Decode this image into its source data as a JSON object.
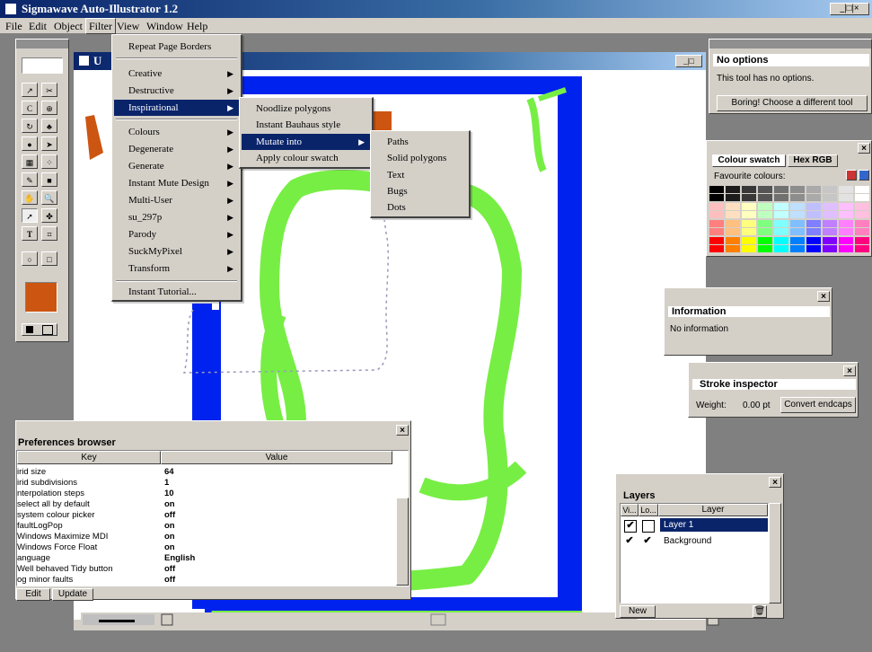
{
  "app": {
    "title": "Sigmawave Auto-Illustrator 1.2",
    "win_controls": "_|□|×"
  },
  "menubar": [
    "File",
    "Edit",
    "Object",
    "Filter",
    "View",
    "Window",
    "Help"
  ],
  "document": {
    "title_visible": "U",
    "controls": "_|□"
  },
  "filter_menu": {
    "items": [
      {
        "label": "Repeat Page Borders",
        "sub": false
      },
      {
        "label": "Creative",
        "sub": true
      },
      {
        "label": "Destructive",
        "sub": true
      },
      {
        "label": "Inspirational",
        "sub": true,
        "highlighted": true
      },
      {
        "label": "Colours",
        "sub": true
      },
      {
        "label": "Degenerate",
        "sub": true
      },
      {
        "label": "Generate",
        "sub": true
      },
      {
        "label": "Instant Mute Design",
        "sub": true
      },
      {
        "label": "Multi-User",
        "sub": true
      },
      {
        "label": "su_297p",
        "sub": true
      },
      {
        "label": "Parody",
        "sub": true
      },
      {
        "label": "SuckMyPixel",
        "sub": true
      },
      {
        "label": "Transform",
        "sub": true
      },
      {
        "label": "Instant Tutorial...",
        "sub": false
      }
    ]
  },
  "inspirational_menu": {
    "items": [
      {
        "label": "Noodlize polygons",
        "sub": false
      },
      {
        "label": "Instant Bauhaus style",
        "sub": false
      },
      {
        "label": "Mutate into",
        "sub": true,
        "highlighted": true
      },
      {
        "label": "Apply colour swatch",
        "sub": false
      }
    ]
  },
  "mutate_menu": {
    "items": [
      "Paths",
      "Solid polygons",
      "Text",
      "Bugs",
      "Dots"
    ]
  },
  "tool_options": {
    "title": "No options",
    "message": "This tool has no options.",
    "button": "Boring! Choose a different tool"
  },
  "colour_panel": {
    "tabs": [
      "Colour swatch",
      "Hex RGB"
    ],
    "favourite_label": "Favourite colours:",
    "colors": {
      "row1": [
        "#000000",
        "#1c1c1c",
        "#383838",
        "#555555",
        "#717171",
        "#8d8d8d",
        "#aaaaaa",
        "#c6c6c6",
        "#e2e2e2",
        "#ffffff"
      ],
      "row2": [
        "#ffbfbf",
        "#ffdfbf",
        "#ffffbf",
        "#bfffbf",
        "#bfffff",
        "#bfdfff",
        "#bfbfff",
        "#dfbfff",
        "#ffbfff",
        "#ffbfdf"
      ],
      "row3": [
        "#ff7f7f",
        "#ffbf7f",
        "#ffff7f",
        "#7fff7f",
        "#7fffff",
        "#7fbfff",
        "#7f7fff",
        "#bf7fff",
        "#ff7fff",
        "#ff7fbf"
      ],
      "row4": [
        "#ff0000",
        "#ff7f00",
        "#ffff00",
        "#00ff00",
        "#00ffff",
        "#007fff",
        "#0000ff",
        "#7f00ff",
        "#ff00ff",
        "#ff007f"
      ]
    }
  },
  "information": {
    "title": "Information",
    "text": "No information"
  },
  "stroke": {
    "title": "Stroke inspector",
    "weight_label": "Weight:",
    "weight_value": "0.00 pt",
    "button": "Convert endcaps"
  },
  "layers": {
    "title": "Layers",
    "cols": [
      "Vi...",
      "Lo...",
      "Layer"
    ],
    "rows": [
      {
        "visible": "✔",
        "locked": "",
        "name": "Layer 1",
        "selected": true
      },
      {
        "visible": "✔",
        "locked": "✔",
        "name": "Background",
        "selected": false
      }
    ],
    "new_button": "New"
  },
  "prefs": {
    "title": "Preferences browser",
    "cols": [
      "Key",
      "Value"
    ],
    "rows": [
      {
        "k": "irid size",
        "v": "64"
      },
      {
        "k": "irid subdivisions",
        "v": "1"
      },
      {
        "k": "nterpolation steps",
        "v": "10"
      },
      {
        "k": "select all by default",
        "v": "on"
      },
      {
        "k": "system colour picker",
        "v": "off"
      },
      {
        "k": "faultLogPop",
        "v": "on"
      },
      {
        "k": "Windows Maximize MDI",
        "v": "on"
      },
      {
        "k": "Windows Force Float",
        "v": "on"
      },
      {
        "k": "anguage",
        "v": "English"
      },
      {
        "k": "Well behaved Tidy button",
        "v": "off"
      },
      {
        "k": "og minor faults",
        "v": "off"
      }
    ],
    "buttons": [
      "Edit",
      "Update"
    ]
  },
  "accent": {
    "blue_border": "#0022ee",
    "green_paint": "#77ee44",
    "orange": "#cc5511"
  }
}
